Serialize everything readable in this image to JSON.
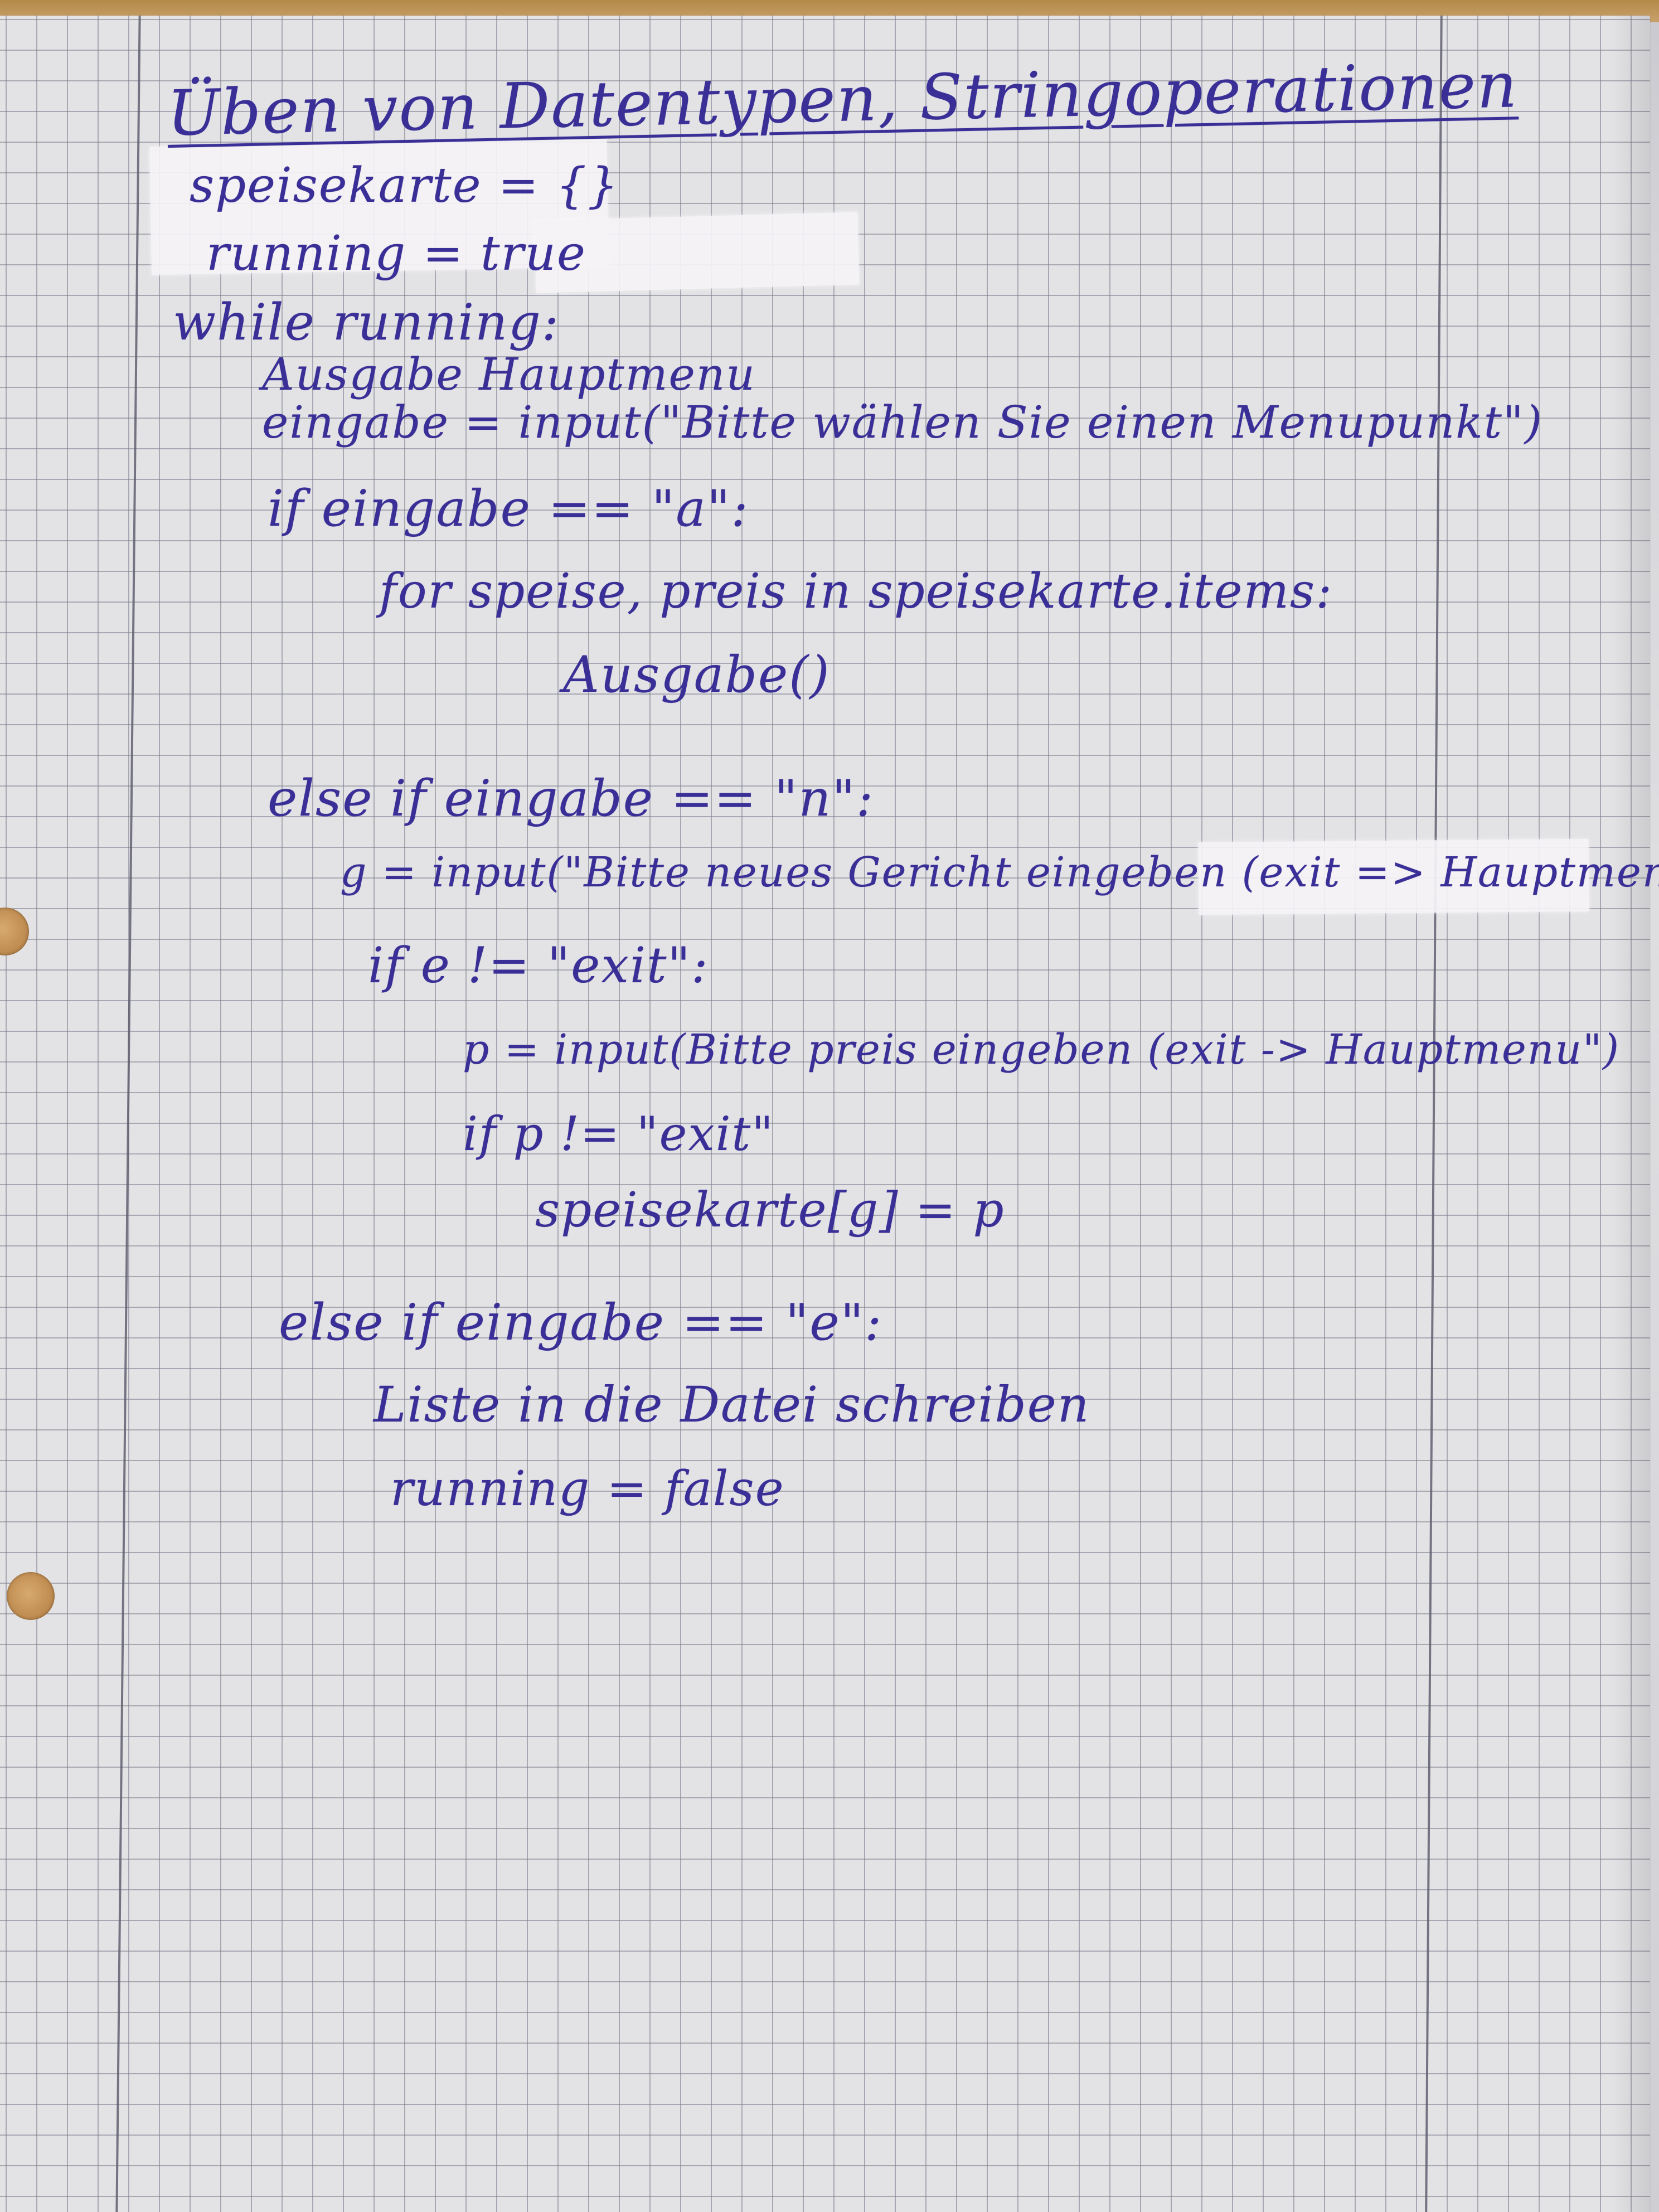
{
  "document": {
    "title": "Üben von Datentypen, Stringoperationen",
    "lines": [
      "speisekarte = {}",
      "running = true",
      "while running:",
      "Ausgabe Hauptmenu",
      "eingabe = input(\"Bitte wählen Sie einen Menupunkt\")",
      "if eingabe == \"a\":",
      "for speise, preis in speisekarte.items:",
      "Ausgabe()",
      "else if eingabe == \"n\":",
      "g = input(\"Bitte neues Gericht eingeben (exit => Hauptmenu\")",
      "if e != \"exit\":",
      "p = input(Bitte preis eingeben (exit -> Hauptmenu\")",
      "if p != \"exit\"",
      "speisekarte[g] = p",
      "else if eingabe == \"e\":",
      "Liste in die Datei schreiben",
      "running = false"
    ]
  },
  "colors": {
    "ink": "#3a2f96",
    "paper": "#e3e3e6",
    "grid": "#787887"
  }
}
